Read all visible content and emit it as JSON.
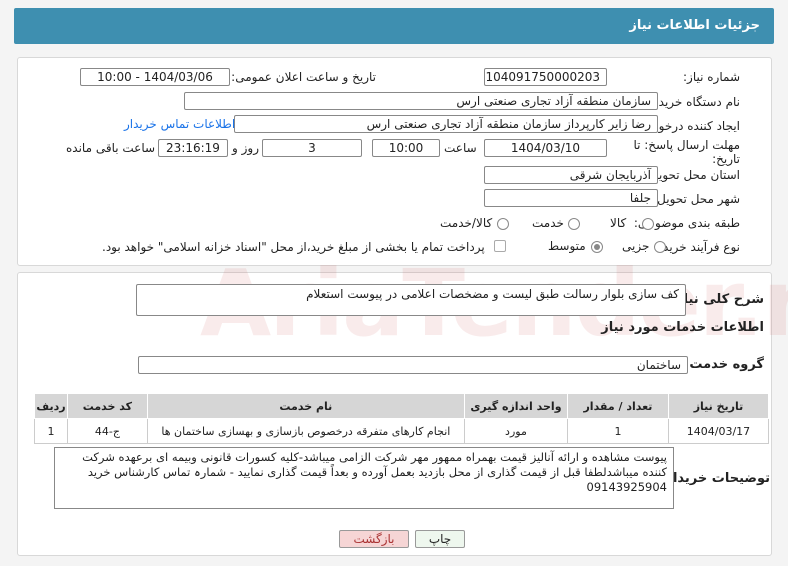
{
  "header": {
    "title": "جزئیات اطلاعات نیاز"
  },
  "form": {
    "need_number_label": "شماره نیاز:",
    "need_number": "1104091750000203",
    "announce_label": "تاریخ و ساعت اعلان عمومی:",
    "announce_value": "1404/03/06 - 10:00",
    "buyer_org_label": "نام دستگاه خریدار:",
    "buyer_org": "سازمان منطقه آزاد تجاری صنعتی ارس",
    "requester_label": "ایجاد کننده درخواست:",
    "requester": "رضا زایر کارپرداز سازمان منطقه آزاد تجاری صنعتی ارس",
    "contact_link": "اطلاعات تماس خریدار",
    "deadline_label_1": "مهلت ارسال پاسخ: تا",
    "deadline_label_2": "تاریخ:",
    "deadline_date": "1404/03/10",
    "time_label": "ساعت",
    "deadline_time": "10:00",
    "days_value": "3",
    "days_label": "روز و",
    "remaining_time": "23:16:19",
    "remaining_label": "ساعت باقی مانده",
    "province_label": "استان محل تحویل:",
    "province": "آذربایجان شرقی",
    "city_label": "شهر محل تحویل:",
    "city": "جلفا",
    "category_label": "طبقه بندی موضوعی:",
    "category_options": [
      "کالا",
      "خدمت",
      "کالا/خدمت"
    ],
    "process_label": "نوع فرآیند خرید :",
    "process_options": [
      "جزیی",
      "متوسط"
    ],
    "payment_note": "پرداخت تمام یا بخشی از مبلغ خرید،از محل \"اسناد خزانه اسلامی\" خواهد بود."
  },
  "summary": {
    "label": "شرح کلی نیاز:",
    "text": "کف سازی بلوار رسالت طبق لیست و مضخصات اعلامی در پیوست استعلام"
  },
  "services": {
    "section_title": "اطلاعات خدمات مورد نیاز",
    "group_label": "گروه خدمت:",
    "group_value": "ساختمان",
    "columns": [
      "ردیف",
      "کد خدمت",
      "نام خدمت",
      "واحد اندازه گیری",
      "تعداد / مقدار",
      "تاریخ نیاز"
    ],
    "rows": [
      [
        "1",
        "ج-44",
        "انجام کارهای متفرقه درخصوص بازسازی و بهسازی ساختمان ها",
        "مورد",
        "1",
        "1404/03/17"
      ]
    ]
  },
  "buyer_notes": {
    "label": "توضیحات خریدار:",
    "text": "پیوست مشاهده و ارائه آنالیز قیمت بهمراه ممهور مهر شرکت الزامی میباشد-کلیه کسورات قانونی وبیمه ای برعهده شرکت کننده میباشدلطفا قبل از قیمت گذاری از محل بازدید بعمل آورده و بعداً قیمت گذاری نمایید - شمارہ تماس کارشناس خرید 09143925904"
  },
  "buttons": {
    "print": "چاپ",
    "back": "بازگشت"
  },
  "watermark": "AriaTender.net",
  "colors": {
    "header": "#3e8fb0",
    "link": "#1a73e8",
    "back_button": "#f6d5d5",
    "print_button": "#eef7ee"
  }
}
